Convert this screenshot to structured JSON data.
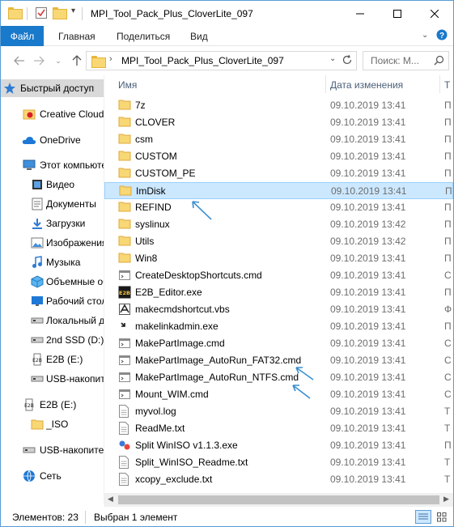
{
  "window": {
    "title": "MPI_Tool_Pack_Plus_CloverLite_097",
    "minimize_glyph": "—",
    "maximize_glyph": "☐",
    "close_glyph": "✕"
  },
  "ribbon": {
    "file_tab": "Файл",
    "tabs": [
      "Главная",
      "Поделиться",
      "Вид"
    ]
  },
  "address": {
    "path": "MPI_Tool_Pack_Plus_CloverLite_097",
    "search_placeholder": "Поиск: M..."
  },
  "nav_pane": {
    "items": [
      {
        "label": "Быстрый доступ",
        "icon": "star-icon",
        "selected": true
      },
      {
        "label": "Creative Cloud Files",
        "icon": "creative-cloud-icon"
      },
      {
        "label": "OneDrive",
        "icon": "onedrive-icon"
      },
      {
        "label": "Этот компьютер",
        "icon": "computer-icon"
      },
      {
        "label": "Видео",
        "icon": "video-icon"
      },
      {
        "label": "Документы",
        "icon": "documents-icon"
      },
      {
        "label": "Загрузки",
        "icon": "downloads-icon"
      },
      {
        "label": "Изображения",
        "icon": "pictures-icon"
      },
      {
        "label": "Музыка",
        "icon": "music-icon"
      },
      {
        "label": "Объемные объекты",
        "icon": "3d-objects-icon"
      },
      {
        "label": "Рабочий стол",
        "icon": "desktop-icon"
      },
      {
        "label": "Локальный диск",
        "icon": "drive-icon"
      },
      {
        "label": "2nd SSD (D:)",
        "icon": "drive-icon"
      },
      {
        "label": "E2B (E:)",
        "icon": "usb-e2b-icon"
      },
      {
        "label": "USB-накопитель",
        "icon": "usb-drive-icon"
      },
      {
        "label": "E2B (E:)",
        "icon": "usb-e2b-icon"
      },
      {
        "label": "_ISO",
        "icon": "folder-icon"
      },
      {
        "label": "USB-накопитель",
        "icon": "usb-drive-icon"
      },
      {
        "label": "Сеть",
        "icon": "network-icon"
      }
    ]
  },
  "file_list": {
    "columns": {
      "name": "Имя",
      "date": "Дата изменения",
      "type": "Т"
    },
    "rows": [
      {
        "name": "7z",
        "date": "09.10.2019 13:41",
        "type": "П",
        "icon": "folder"
      },
      {
        "name": "CLOVER",
        "date": "09.10.2019 13:41",
        "type": "П",
        "icon": "folder"
      },
      {
        "name": "csm",
        "date": "09.10.2019 13:41",
        "type": "П",
        "icon": "folder"
      },
      {
        "name": "CUSTOM",
        "date": "09.10.2019 13:41",
        "type": "П",
        "icon": "folder"
      },
      {
        "name": "CUSTOM_PE",
        "date": "09.10.2019 13:41",
        "type": "П",
        "icon": "folder"
      },
      {
        "name": "ImDisk",
        "date": "09.10.2019 13:41",
        "type": "П",
        "icon": "folder",
        "selected": true
      },
      {
        "name": "REFIND",
        "date": "09.10.2019 13:41",
        "type": "П",
        "icon": "folder"
      },
      {
        "name": "syslinux",
        "date": "09.10.2019 13:42",
        "type": "П",
        "icon": "folder"
      },
      {
        "name": "Utils",
        "date": "09.10.2019 13:42",
        "type": "П",
        "icon": "folder"
      },
      {
        "name": "Win8",
        "date": "09.10.2019 13:41",
        "type": "П",
        "icon": "folder"
      },
      {
        "name": "CreateDesktopShortcuts.cmd",
        "date": "09.10.2019 13:41",
        "type": "С",
        "icon": "cmd"
      },
      {
        "name": "E2B_Editor.exe",
        "date": "09.10.2019 13:41",
        "type": "П",
        "icon": "e2b-exe"
      },
      {
        "name": "makecmdshortcut.vbs",
        "date": "09.10.2019 13:41",
        "type": "Ф",
        "icon": "vbs"
      },
      {
        "name": "makelinkadmin.exe",
        "date": "09.10.2019 13:41",
        "type": "П",
        "icon": "exe"
      },
      {
        "name": "MakePartImage.cmd",
        "date": "09.10.2019 13:41",
        "type": "С",
        "icon": "cmd"
      },
      {
        "name": "MakePartImage_AutoRun_FAT32.cmd",
        "date": "09.10.2019 13:41",
        "type": "С",
        "icon": "cmd"
      },
      {
        "name": "MakePartImage_AutoRun_NTFS.cmd",
        "date": "09.10.2019 13:41",
        "type": "С",
        "icon": "cmd"
      },
      {
        "name": "Mount_WIM.cmd",
        "date": "09.10.2019 13:41",
        "type": "С",
        "icon": "cmd"
      },
      {
        "name": "myvol.log",
        "date": "09.10.2019 13:41",
        "type": "Т",
        "icon": "doc"
      },
      {
        "name": "ReadMe.txt",
        "date": "09.10.2019 13:41",
        "type": "Т",
        "icon": "doc"
      },
      {
        "name": "Split WinISO v1.1.3.exe",
        "date": "09.10.2019 13:41",
        "type": "П",
        "icon": "split-exe"
      },
      {
        "name": "Split_WinISO_Readme.txt",
        "date": "09.10.2019 13:41",
        "type": "Т",
        "icon": "doc"
      },
      {
        "name": "xcopy_exclude.txt",
        "date": "09.10.2019 13:41",
        "type": "Т",
        "icon": "doc"
      }
    ]
  },
  "status_bar": {
    "items_count": "Элементов: 23",
    "selected_count": "Выбран 1 элемент"
  },
  "colors": {
    "accent": "#1979ca",
    "selection": "#cce8ff",
    "annotation_arrow": "#3a8fd0"
  }
}
